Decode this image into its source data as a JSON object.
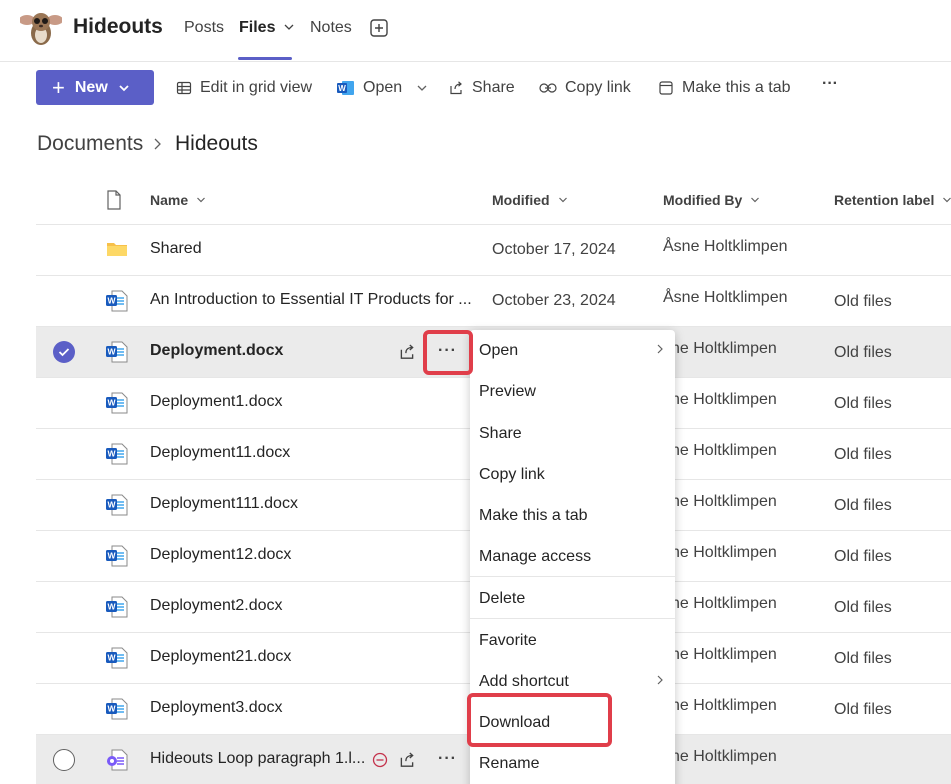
{
  "header": {
    "team_name": "Hideouts",
    "tabs": [
      {
        "label": "Posts",
        "active": false
      },
      {
        "label": "Files",
        "active": true
      },
      {
        "label": "Notes",
        "active": false
      }
    ],
    "accent": "#5b5fc7"
  },
  "toolbar": {
    "new_label": "New",
    "edit_grid": "Edit in grid view",
    "open": "Open",
    "share": "Share",
    "copy_link": "Copy link",
    "make_tab": "Make this a tab",
    "more": "···"
  },
  "breadcrumb": {
    "root": "Documents",
    "current": "Hideouts"
  },
  "columns": {
    "name": "Name",
    "modified": "Modified",
    "modified_by": "Modified By",
    "retention": "Retention label"
  },
  "rows": [
    {
      "icon": "folder-icon",
      "name": "Shared",
      "modified": "October 17, 2024",
      "modified_by": "Åsne Holtklimpen",
      "retention": ""
    },
    {
      "icon": "word-doc-icon",
      "name": "An Introduction to Essential IT Products for ...",
      "modified": "October 23, 2024",
      "modified_by": "Åsne Holtklimpen",
      "retention": "Old files"
    },
    {
      "icon": "word-doc-icon",
      "name": "Deployment.docx",
      "modified": "",
      "modified_by": "sne Holtklimpen",
      "retention": "Old files",
      "selected": true
    },
    {
      "icon": "word-doc-icon",
      "name": "Deployment1.docx",
      "modified": "",
      "modified_by": "sne Holtklimpen",
      "retention": "Old files"
    },
    {
      "icon": "word-doc-icon",
      "name": "Deployment11.docx",
      "modified": "",
      "modified_by": "sne Holtklimpen",
      "retention": "Old files"
    },
    {
      "icon": "word-doc-icon",
      "name": "Deployment111.docx",
      "modified": "",
      "modified_by": "sne Holtklimpen",
      "retention": "Old files"
    },
    {
      "icon": "word-doc-icon",
      "name": "Deployment12.docx",
      "modified": "",
      "modified_by": "sne Holtklimpen",
      "retention": "Old files"
    },
    {
      "icon": "word-doc-icon",
      "name": "Deployment2.docx",
      "modified": "",
      "modified_by": "sne Holtklimpen",
      "retention": "Old files"
    },
    {
      "icon": "word-doc-icon",
      "name": "Deployment21.docx",
      "modified": "",
      "modified_by": "sne Holtklimpen",
      "retention": "Old files"
    },
    {
      "icon": "word-doc-icon",
      "name": "Deployment3.docx",
      "modified": "",
      "modified_by": "sne Holtklimpen",
      "retention": "Old files"
    },
    {
      "icon": "loop-icon",
      "name": "Hideouts Loop paragraph 1.l...",
      "modified": "",
      "modified_by": "sne Holtklimpen",
      "retention": ""
    }
  ],
  "context_menu": {
    "items": [
      {
        "label": "Open",
        "submenu": true
      },
      {
        "label": "Preview"
      },
      {
        "label": "Share"
      },
      {
        "label": "Copy link"
      },
      {
        "label": "Make this a tab"
      },
      {
        "label": "Manage access"
      },
      {
        "label": "Delete"
      },
      {
        "label": "Favorite"
      },
      {
        "label": "Add shortcut",
        "submenu": true
      },
      {
        "label": "Download",
        "highlighted": true
      },
      {
        "label": "Rename"
      }
    ]
  },
  "highlight_color": "#e03e4a"
}
